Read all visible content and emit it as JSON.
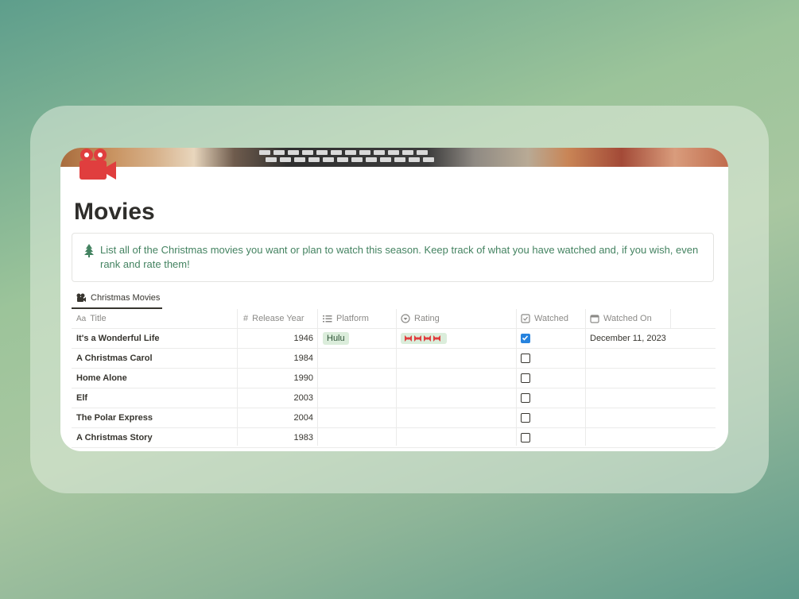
{
  "page": {
    "title": "Movies",
    "icon": "movie-camera-icon",
    "callout_icon": "christmas-tree-icon",
    "callout_text": "List all of the Christmas movies you want or plan to watch this season. Keep track of what you have watched and, if you wish, even rank and rate them!"
  },
  "view_tab": {
    "icon": "movie-camera-icon",
    "label": "Christmas Movies"
  },
  "columns": {
    "title": {
      "icon": "Aa",
      "label": "Title"
    },
    "release_year": {
      "icon": "#",
      "label": "Release Year"
    },
    "platform": {
      "icon": "list-icon",
      "label": "Platform"
    },
    "rating": {
      "icon": "select-icon",
      "label": "Rating"
    },
    "watched": {
      "icon": "checkbox-icon",
      "label": "Watched"
    },
    "watched_on": {
      "icon": "calendar-icon",
      "label": "Watched On"
    }
  },
  "rows": [
    {
      "title": "It's a Wonderful Life",
      "year": "1946",
      "platform": "Hulu",
      "rating": "🎀🎀🎀🎀",
      "watched": true,
      "watched_on": "December 11, 2023"
    },
    {
      "title": "A Christmas Carol",
      "year": "1984",
      "platform": "",
      "rating": "",
      "watched": false,
      "watched_on": ""
    },
    {
      "title": "Home Alone",
      "year": "1990",
      "platform": "",
      "rating": "",
      "watched": false,
      "watched_on": ""
    },
    {
      "title": "Elf",
      "year": "2003",
      "platform": "",
      "rating": "",
      "watched": false,
      "watched_on": ""
    },
    {
      "title": "The Polar Express",
      "year": "2004",
      "platform": "",
      "rating": "",
      "watched": false,
      "watched_on": ""
    },
    {
      "title": "A Christmas Story",
      "year": "1983",
      "platform": "",
      "rating": "",
      "watched": false,
      "watched_on": ""
    }
  ],
  "colors": {
    "callout_text": "#448361",
    "tag_bg": "#dbeddb",
    "checkbox_on": "#2783de",
    "icon_red": "#e03e3e"
  }
}
